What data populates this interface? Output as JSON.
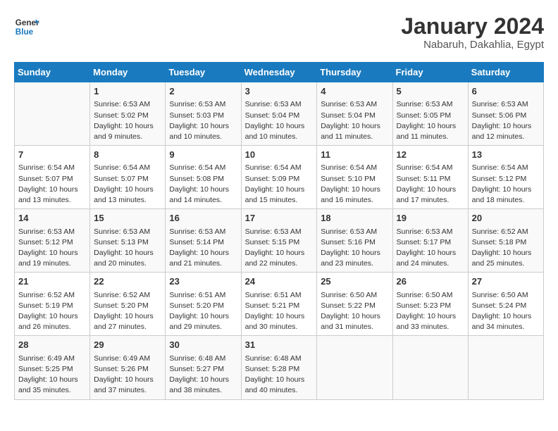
{
  "logo": {
    "general": "General",
    "blue": "Blue"
  },
  "title": "January 2024",
  "subtitle": "Nabaruh, Dakahlia, Egypt",
  "headers": [
    "Sunday",
    "Monday",
    "Tuesday",
    "Wednesday",
    "Thursday",
    "Friday",
    "Saturday"
  ],
  "weeks": [
    [
      {
        "day": "",
        "info": ""
      },
      {
        "day": "1",
        "info": "Sunrise: 6:53 AM\nSunset: 5:02 PM\nDaylight: 10 hours\nand 9 minutes."
      },
      {
        "day": "2",
        "info": "Sunrise: 6:53 AM\nSunset: 5:03 PM\nDaylight: 10 hours\nand 10 minutes."
      },
      {
        "day": "3",
        "info": "Sunrise: 6:53 AM\nSunset: 5:04 PM\nDaylight: 10 hours\nand 10 minutes."
      },
      {
        "day": "4",
        "info": "Sunrise: 6:53 AM\nSunset: 5:04 PM\nDaylight: 10 hours\nand 11 minutes."
      },
      {
        "day": "5",
        "info": "Sunrise: 6:53 AM\nSunset: 5:05 PM\nDaylight: 10 hours\nand 11 minutes."
      },
      {
        "day": "6",
        "info": "Sunrise: 6:53 AM\nSunset: 5:06 PM\nDaylight: 10 hours\nand 12 minutes."
      }
    ],
    [
      {
        "day": "7",
        "info": "Sunrise: 6:54 AM\nSunset: 5:07 PM\nDaylight: 10 hours\nand 13 minutes."
      },
      {
        "day": "8",
        "info": "Sunrise: 6:54 AM\nSunset: 5:07 PM\nDaylight: 10 hours\nand 13 minutes."
      },
      {
        "day": "9",
        "info": "Sunrise: 6:54 AM\nSunset: 5:08 PM\nDaylight: 10 hours\nand 14 minutes."
      },
      {
        "day": "10",
        "info": "Sunrise: 6:54 AM\nSunset: 5:09 PM\nDaylight: 10 hours\nand 15 minutes."
      },
      {
        "day": "11",
        "info": "Sunrise: 6:54 AM\nSunset: 5:10 PM\nDaylight: 10 hours\nand 16 minutes."
      },
      {
        "day": "12",
        "info": "Sunrise: 6:54 AM\nSunset: 5:11 PM\nDaylight: 10 hours\nand 17 minutes."
      },
      {
        "day": "13",
        "info": "Sunrise: 6:54 AM\nSunset: 5:12 PM\nDaylight: 10 hours\nand 18 minutes."
      }
    ],
    [
      {
        "day": "14",
        "info": "Sunrise: 6:53 AM\nSunset: 5:12 PM\nDaylight: 10 hours\nand 19 minutes."
      },
      {
        "day": "15",
        "info": "Sunrise: 6:53 AM\nSunset: 5:13 PM\nDaylight: 10 hours\nand 20 minutes."
      },
      {
        "day": "16",
        "info": "Sunrise: 6:53 AM\nSunset: 5:14 PM\nDaylight: 10 hours\nand 21 minutes."
      },
      {
        "day": "17",
        "info": "Sunrise: 6:53 AM\nSunset: 5:15 PM\nDaylight: 10 hours\nand 22 minutes."
      },
      {
        "day": "18",
        "info": "Sunrise: 6:53 AM\nSunset: 5:16 PM\nDaylight: 10 hours\nand 23 minutes."
      },
      {
        "day": "19",
        "info": "Sunrise: 6:53 AM\nSunset: 5:17 PM\nDaylight: 10 hours\nand 24 minutes."
      },
      {
        "day": "20",
        "info": "Sunrise: 6:52 AM\nSunset: 5:18 PM\nDaylight: 10 hours\nand 25 minutes."
      }
    ],
    [
      {
        "day": "21",
        "info": "Sunrise: 6:52 AM\nSunset: 5:19 PM\nDaylight: 10 hours\nand 26 minutes."
      },
      {
        "day": "22",
        "info": "Sunrise: 6:52 AM\nSunset: 5:20 PM\nDaylight: 10 hours\nand 27 minutes."
      },
      {
        "day": "23",
        "info": "Sunrise: 6:51 AM\nSunset: 5:20 PM\nDaylight: 10 hours\nand 29 minutes."
      },
      {
        "day": "24",
        "info": "Sunrise: 6:51 AM\nSunset: 5:21 PM\nDaylight: 10 hours\nand 30 minutes."
      },
      {
        "day": "25",
        "info": "Sunrise: 6:50 AM\nSunset: 5:22 PM\nDaylight: 10 hours\nand 31 minutes."
      },
      {
        "day": "26",
        "info": "Sunrise: 6:50 AM\nSunset: 5:23 PM\nDaylight: 10 hours\nand 33 minutes."
      },
      {
        "day": "27",
        "info": "Sunrise: 6:50 AM\nSunset: 5:24 PM\nDaylight: 10 hours\nand 34 minutes."
      }
    ],
    [
      {
        "day": "28",
        "info": "Sunrise: 6:49 AM\nSunset: 5:25 PM\nDaylight: 10 hours\nand 35 minutes."
      },
      {
        "day": "29",
        "info": "Sunrise: 6:49 AM\nSunset: 5:26 PM\nDaylight: 10 hours\nand 37 minutes."
      },
      {
        "day": "30",
        "info": "Sunrise: 6:48 AM\nSunset: 5:27 PM\nDaylight: 10 hours\nand 38 minutes."
      },
      {
        "day": "31",
        "info": "Sunrise: 6:48 AM\nSunset: 5:28 PM\nDaylight: 10 hours\nand 40 minutes."
      },
      {
        "day": "",
        "info": ""
      },
      {
        "day": "",
        "info": ""
      },
      {
        "day": "",
        "info": ""
      }
    ]
  ]
}
